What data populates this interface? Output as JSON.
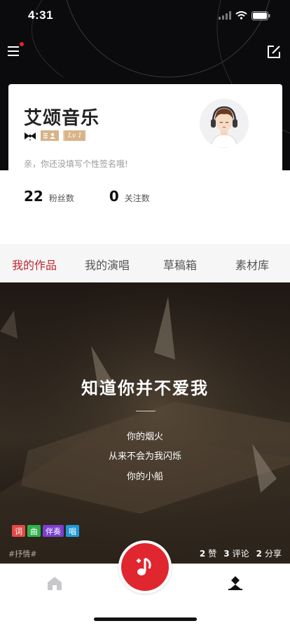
{
  "status_bar": {
    "time": "4:31"
  },
  "profile": {
    "name": "艾颂音乐",
    "level": "Lv 1",
    "signature": "亲，你还没填写个性签名哦!",
    "fans_count": "22",
    "fans_label": "粉丝数",
    "following_count": "0",
    "following_label": "关注数"
  },
  "tabs": [
    {
      "label": "我的作品",
      "active": true
    },
    {
      "label": "我的演唱",
      "active": false
    },
    {
      "label": "草稿箱",
      "active": false
    },
    {
      "label": "素材库",
      "active": false
    }
  ],
  "work": {
    "title": "知道你并不爱我",
    "lyrics": [
      "你的烟火",
      "从来不会为我闪烁",
      "你的小船"
    ],
    "tags": [
      {
        "label": "词",
        "color": "#e04a45"
      },
      {
        "label": "曲",
        "color": "#2fb04a"
      },
      {
        "label": "伴奏",
        "color": "#7b3fd0"
      },
      {
        "label": "唱",
        "color": "#1e9ad6"
      }
    ],
    "hashtag": "#抒情#",
    "likes_count": "2",
    "likes_label": "赞",
    "comments_count": "3",
    "comments_label": "评论",
    "shares_count": "2",
    "shares_label": "分享"
  },
  "colors": {
    "accent": "#c0262d",
    "fab": "#e0272f",
    "header_bg": "#0b0b0d"
  },
  "icons": [
    "menu-icon",
    "edit-icon",
    "home-icon",
    "me-icon",
    "music-add-icon"
  ]
}
